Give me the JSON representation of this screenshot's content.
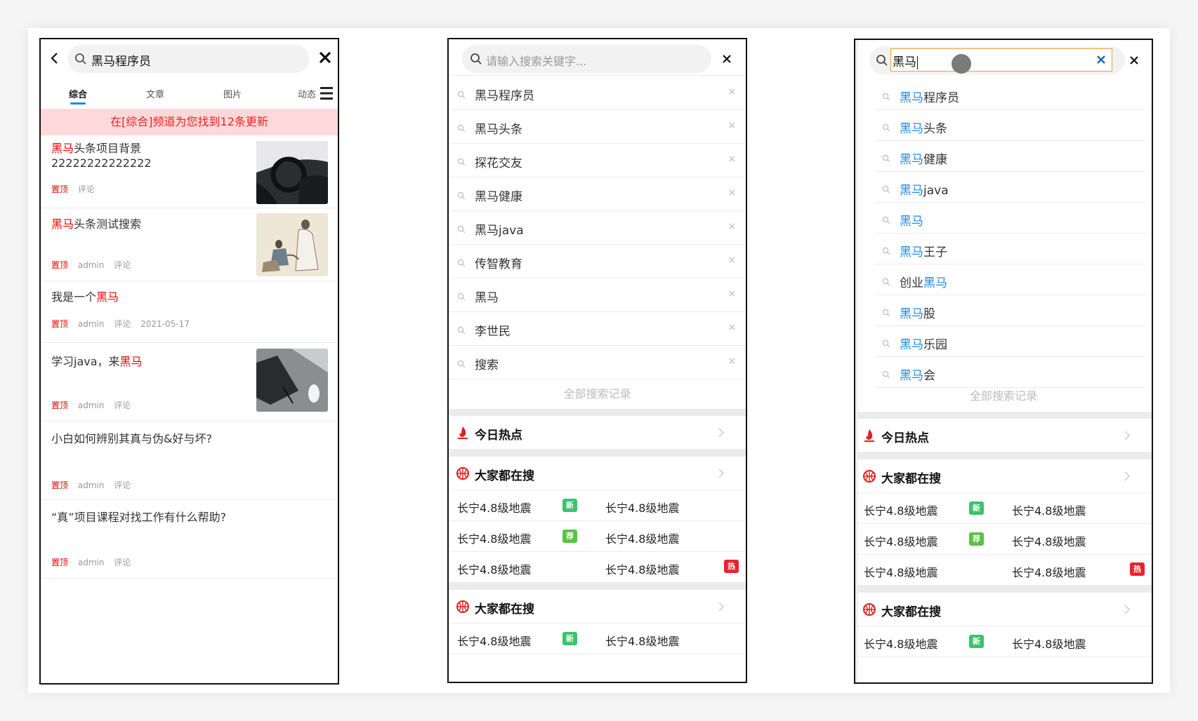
{
  "panel1": {
    "search_text": "黑马程序员",
    "tabs": [
      "综合",
      "文章",
      "图片",
      "动态"
    ],
    "notice": "在[综合]频道为您找到12条更新",
    "articles": [
      {
        "hl": "黑马",
        "rest": "头条项目背景 22222222222222",
        "pin": "置顶",
        "author": "",
        "comment": "评论",
        "date": "",
        "thumb": "car"
      },
      {
        "hl": "黑马",
        "rest": "头条测试搜索",
        "pin": "置顶",
        "author": "admin",
        "comment": "评论",
        "date": "",
        "thumb": "painting"
      },
      {
        "pre": "我是一个",
        "hl": "黑马",
        "pin": "置顶",
        "author": "admin",
        "comment": "评论",
        "date": "2021-05-17"
      },
      {
        "pre": "学习java，来",
        "hl": "黑马",
        "pin": "置顶",
        "author": "admin",
        "comment": "评论",
        "date": "",
        "thumb": "desk"
      },
      {
        "pre": "小白如何辨别其真与伪&好与坏?",
        "pin": "置顶",
        "author": "admin",
        "comment": "评论",
        "date": ""
      },
      {
        "pre": "“真”项目课程对找工作有什么帮助?",
        "pin": "置顶",
        "author": "admin",
        "comment": "评论",
        "date": ""
      }
    ]
  },
  "panel2": {
    "placeholder": "请输入搜索关键字...",
    "history": [
      "黑马程序员",
      "黑马头条",
      "探花交友",
      "黑马健康",
      "黑马java",
      "传智教育",
      "黑马",
      "李世民",
      "搜索"
    ],
    "delete_mark": "×",
    "all_history": "全部搜索记录",
    "hot_today": "今日热点",
    "everyone": "大家都在搜",
    "hot_rows": [
      {
        "left": "长宁4.8级地震",
        "badge": "新",
        "badge_color": "#3cc36b",
        "right": "长宁4.8级地震",
        "right_badge": ""
      },
      {
        "left": "长宁4.8级地震",
        "badge": "荐",
        "badge_color": "#5ac342",
        "right": "长宁4.8级地震",
        "right_badge": ""
      },
      {
        "left": "长宁4.8级地震",
        "badge": "",
        "right": "长宁4.8级地震",
        "right_badge": "热",
        "right_badge_color": "#e8232c"
      }
    ],
    "everyone2": "大家都在搜",
    "hot_rows2": [
      {
        "left": "长宁4.8级地震",
        "badge": "新",
        "badge_color": "#3cc36b",
        "right": "长宁4.8级地震"
      }
    ]
  },
  "panel3": {
    "input_value": "黑马",
    "suggestions": [
      {
        "pre": "",
        "hl": "黑马",
        "post": "程序员"
      },
      {
        "pre": "",
        "hl": "黑马",
        "post": "头条"
      },
      {
        "pre": "",
        "hl": "黑马",
        "post": "健康"
      },
      {
        "pre": "",
        "hl": "黑马",
        "post": "java"
      },
      {
        "pre": "",
        "hl": "黑马",
        "post": ""
      },
      {
        "pre": "",
        "hl": "黑马",
        "post": "王子"
      },
      {
        "pre": "创业",
        "hl": "黑马",
        "post": ""
      },
      {
        "pre": "",
        "hl": "黑马",
        "post": "股"
      },
      {
        "pre": "",
        "hl": "黑马",
        "post": "乐园"
      },
      {
        "pre": "",
        "hl": "黑马",
        "post": "会"
      }
    ],
    "all_history": "全部搜索记录",
    "hot_today": "今日热点",
    "everyone": "大家都在搜",
    "hot_rows": [
      {
        "left": "长宁4.8级地震",
        "badge": "新",
        "badge_color": "#3cc36b",
        "right": "长宁4.8级地震",
        "right_badge": ""
      },
      {
        "left": "长宁4.8级地震",
        "badge": "荐",
        "badge_color": "#5ac342",
        "right": "长宁4.8级地震",
        "right_badge": ""
      },
      {
        "left": "长宁4.8级地震",
        "badge": "",
        "right": "长宁4.8级地震",
        "right_badge": "热",
        "right_badge_color": "#e8232c"
      }
    ],
    "everyone2": "大家都在搜",
    "hot_rows2": [
      {
        "left": "长宁4.8级地震",
        "badge": "新",
        "badge_color": "#3cc36b",
        "right": "长宁4.8级地震"
      }
    ]
  }
}
